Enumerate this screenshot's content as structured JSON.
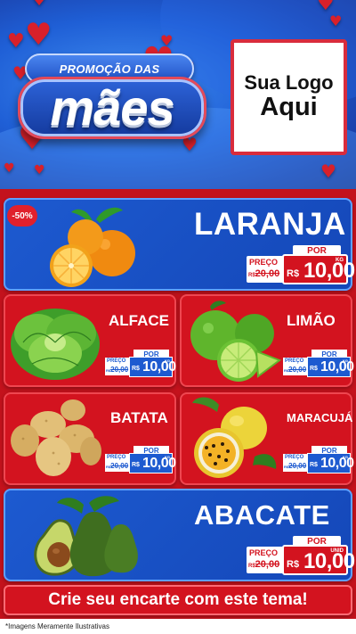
{
  "header": {
    "promo_line": "PROMOÇÃO DAS",
    "promo_word": "mães",
    "logo_line1": "Sua Logo",
    "logo_line2": "Aqui"
  },
  "colors": {
    "blue": "#1d5ad0",
    "red": "#d3131f",
    "white": "#ffffff"
  },
  "products": {
    "laranja": {
      "name": "LARANJA",
      "discount": "-50%",
      "por": "POR",
      "preco_label": "PREÇO",
      "old_currency": "R$",
      "old_price": "20,00",
      "currency": "R$",
      "price": "10,00",
      "unit": "KG"
    },
    "alface": {
      "name": "ALFACE",
      "por": "POR",
      "preco_label": "PREÇO",
      "old_currency": "R$",
      "old_price": "20,00",
      "currency": "R$",
      "price": "10,00",
      "unit": "KG"
    },
    "limao": {
      "name": "LIMÃO",
      "por": "POR",
      "preco_label": "PREÇO",
      "old_currency": "R$",
      "old_price": "20,00",
      "currency": "R$",
      "price": "10,00",
      "unit": "KG"
    },
    "batata": {
      "name": "BATATA",
      "por": "POR",
      "preco_label": "PREÇO",
      "old_currency": "R$",
      "old_price": "20,00",
      "currency": "R$",
      "price": "10,00",
      "unit": "KG"
    },
    "maracuja": {
      "name": "MARACUJÁ",
      "por": "POR",
      "preco_label": "PREÇO",
      "old_currency": "R$",
      "old_price": "20,00",
      "currency": "R$",
      "price": "10,00",
      "unit": "KG"
    },
    "abacate": {
      "name": "ABACATE",
      "por": "POR",
      "preco_label": "PREÇO",
      "old_currency": "R$",
      "old_price": "20,00",
      "currency": "R$",
      "price": "10,00",
      "unit": "UNID"
    }
  },
  "cta": {
    "label": "Crie seu encarte com este tema!"
  },
  "footer": {
    "note": "*Imagens Meramente Ilustrativas"
  }
}
